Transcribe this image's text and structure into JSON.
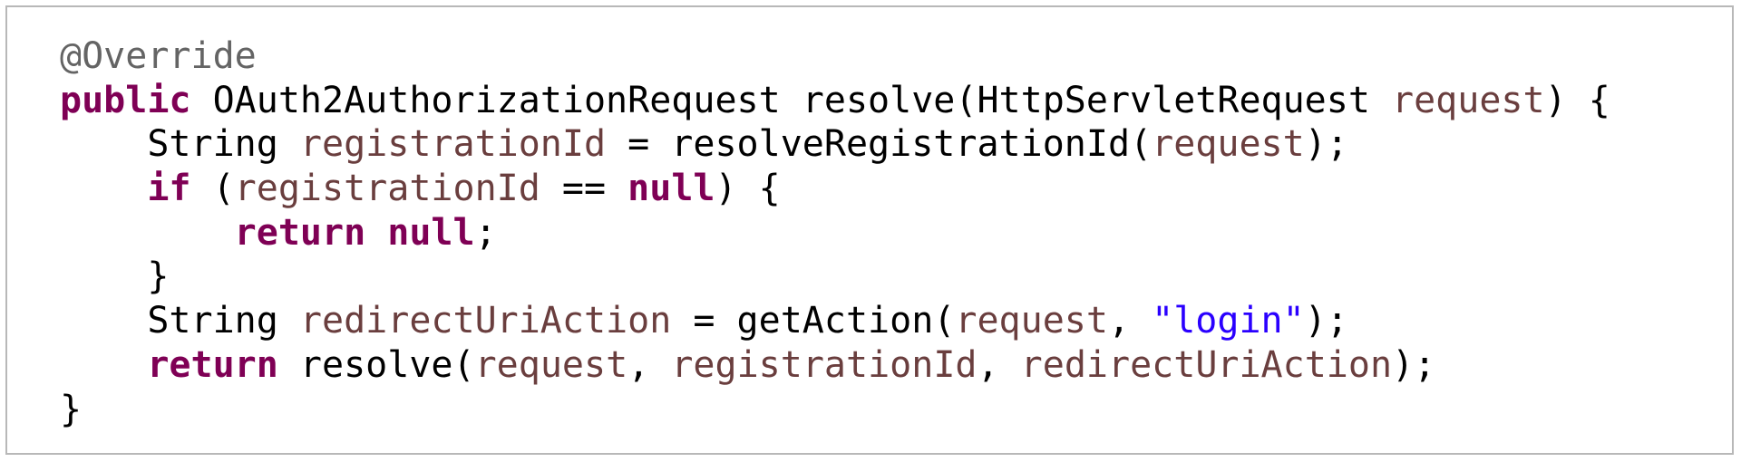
{
  "colors": {
    "keyword": "#7f0055",
    "variable": "#6a3e3e",
    "string": "#2a00ff",
    "annotation": "#646464",
    "text": "#000000",
    "border": "#b8b8b8"
  },
  "code": {
    "lines": [
      [
        {
          "t": "@Override",
          "c": "annotation"
        }
      ],
      [
        {
          "t": "public",
          "c": "kw"
        },
        {
          "t": " OAuth2AuthorizationRequest resolve(HttpServletRequest ",
          "c": "plain"
        },
        {
          "t": "request",
          "c": "var"
        },
        {
          "t": ") {",
          "c": "plain"
        }
      ],
      [
        {
          "t": "    String ",
          "c": "plain"
        },
        {
          "t": "registrationId",
          "c": "var"
        },
        {
          "t": " = resolveRegistrationId(",
          "c": "plain"
        },
        {
          "t": "request",
          "c": "var"
        },
        {
          "t": ");",
          "c": "plain"
        }
      ],
      [
        {
          "t": "    ",
          "c": "plain"
        },
        {
          "t": "if",
          "c": "kw"
        },
        {
          "t": " (",
          "c": "plain"
        },
        {
          "t": "registrationId",
          "c": "var"
        },
        {
          "t": " == ",
          "c": "plain"
        },
        {
          "t": "null",
          "c": "kw"
        },
        {
          "t": ") {",
          "c": "plain"
        }
      ],
      [
        {
          "t": "        ",
          "c": "plain"
        },
        {
          "t": "return",
          "c": "kw"
        },
        {
          "t": " ",
          "c": "plain"
        },
        {
          "t": "null",
          "c": "kw"
        },
        {
          "t": ";",
          "c": "plain"
        }
      ],
      [
        {
          "t": "    }",
          "c": "plain"
        }
      ],
      [
        {
          "t": "    String ",
          "c": "plain"
        },
        {
          "t": "redirectUriAction",
          "c": "var"
        },
        {
          "t": " = getAction(",
          "c": "plain"
        },
        {
          "t": "request",
          "c": "var"
        },
        {
          "t": ", ",
          "c": "plain"
        },
        {
          "t": "\"login\"",
          "c": "str"
        },
        {
          "t": ");",
          "c": "plain"
        }
      ],
      [
        {
          "t": "    ",
          "c": "plain"
        },
        {
          "t": "return",
          "c": "kw"
        },
        {
          "t": " resolve(",
          "c": "plain"
        },
        {
          "t": "request",
          "c": "var"
        },
        {
          "t": ", ",
          "c": "plain"
        },
        {
          "t": "registrationId",
          "c": "var"
        },
        {
          "t": ", ",
          "c": "plain"
        },
        {
          "t": "redirectUriAction",
          "c": "var"
        },
        {
          "t": ");",
          "c": "plain"
        }
      ],
      [
        {
          "t": "}",
          "c": "plain"
        }
      ]
    ]
  }
}
